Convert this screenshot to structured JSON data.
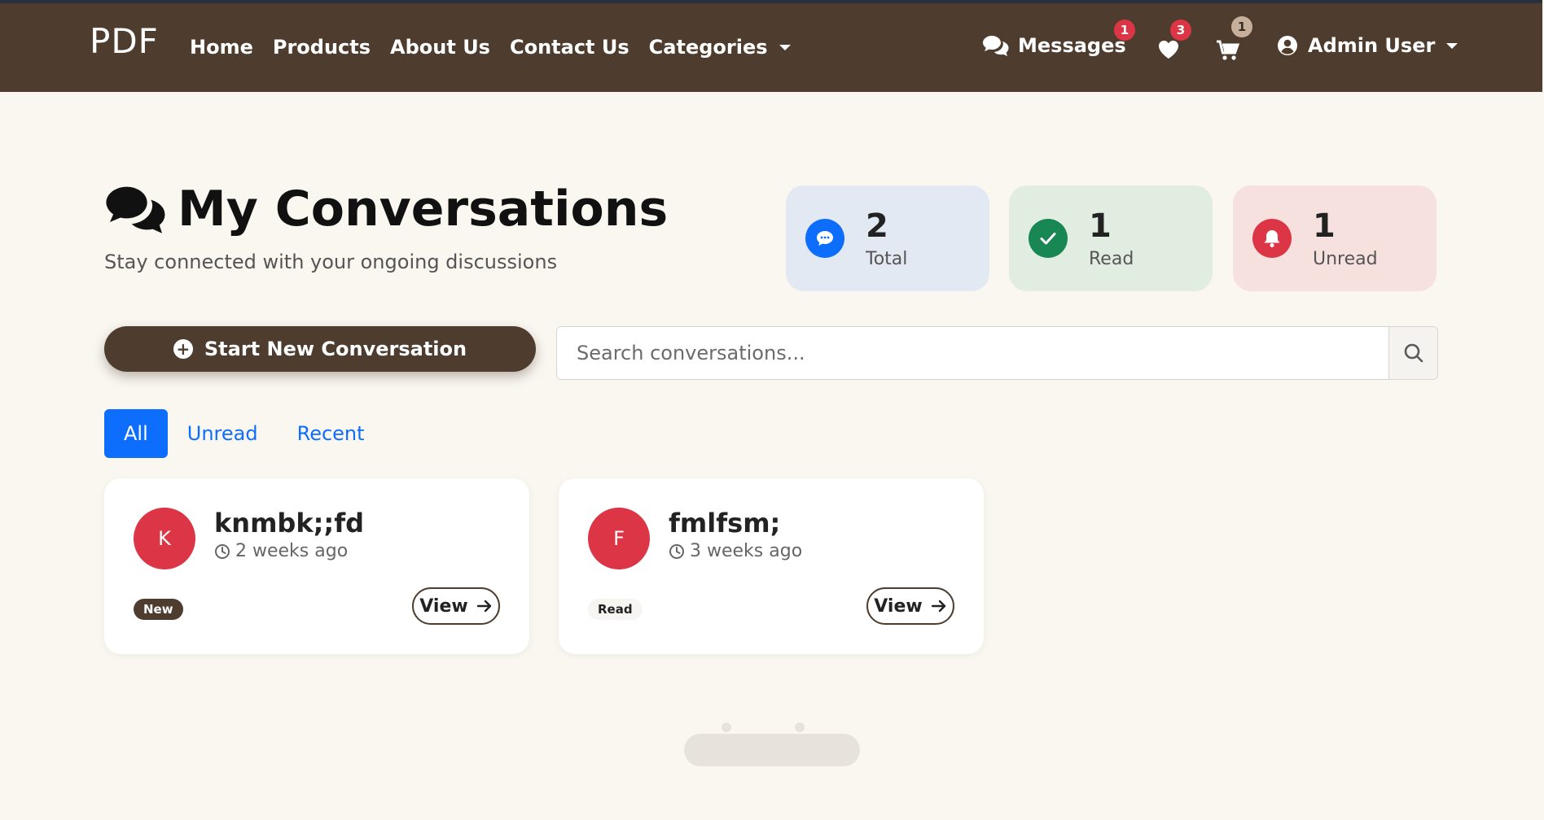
{
  "navbar": {
    "brand": "PDF",
    "links": [
      "Home",
      "Products",
      "About Us",
      "Contact Us"
    ],
    "categories_label": "Categories",
    "messages_label": "Messages",
    "messages_badge": "1",
    "wishlist_badge": "3",
    "cart_badge": "1",
    "user_label": "Admin User"
  },
  "header": {
    "title": "My Conversations",
    "subtitle": "Stay connected with your ongoing discussions"
  },
  "stats": [
    {
      "value": "2",
      "label": "Total",
      "bg": "#e3e9f2",
      "icon_bg": "#0d6efd",
      "icon": "chat-dots-icon"
    },
    {
      "value": "1",
      "label": "Read",
      "bg": "#e2ede2",
      "icon_bg": "#198754",
      "icon": "check-icon"
    },
    {
      "value": "1",
      "label": "Unread",
      "bg": "#f6e1de",
      "icon_bg": "#dc3545",
      "icon": "bell-icon"
    }
  ],
  "actions": {
    "start_label": "Start New Conversation",
    "search_placeholder": "Search conversations..."
  },
  "tabs": [
    "All",
    "Unread",
    "Recent"
  ],
  "active_tab": "All",
  "conversations": [
    {
      "initial": "K",
      "name": "knmbk;;fd",
      "time": "2 weeks ago",
      "status": "New",
      "view_label": "View"
    },
    {
      "initial": "F",
      "name": "fmlfsm;",
      "time": "3 weeks ago",
      "status": "Read",
      "view_label": "View"
    }
  ],
  "colors": {
    "brand_brown": "#4e3d2e",
    "page_bg": "#faf6f0",
    "primary_blue": "#0d6efd",
    "danger_red": "#dc3545"
  }
}
